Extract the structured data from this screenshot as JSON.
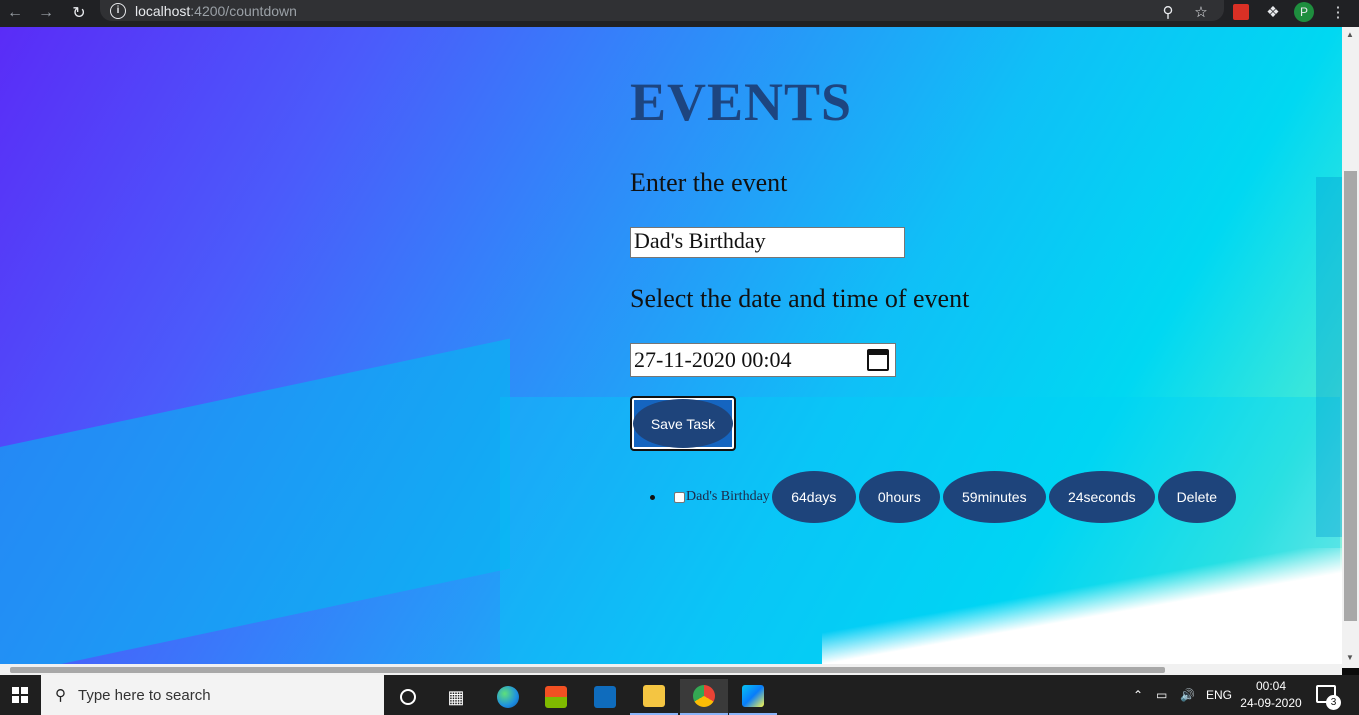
{
  "browser": {
    "url_host": "localhost",
    "url_path": ":4200/countdown",
    "avatar_letter": "P"
  },
  "page": {
    "title": "EVENTS",
    "event_label": "Enter the event",
    "event_value": "Dad's Birthday",
    "date_label": "Select the date and time of event",
    "date_value": "27-11-2020 00:04",
    "save_label": "Save Task"
  },
  "tasks": [
    {
      "name": "Dad's Birthday",
      "days": "64days",
      "hours": "0hours",
      "minutes": "59minutes",
      "seconds": "24seconds",
      "delete_label": "Delete"
    }
  ],
  "taskbar": {
    "search_placeholder": "Type here to search",
    "language": "ENG",
    "time": "00:04",
    "date": "24-09-2020",
    "notification_count": "3"
  },
  "colors": {
    "accent": "#1e447b",
    "title": "#1d4580"
  }
}
